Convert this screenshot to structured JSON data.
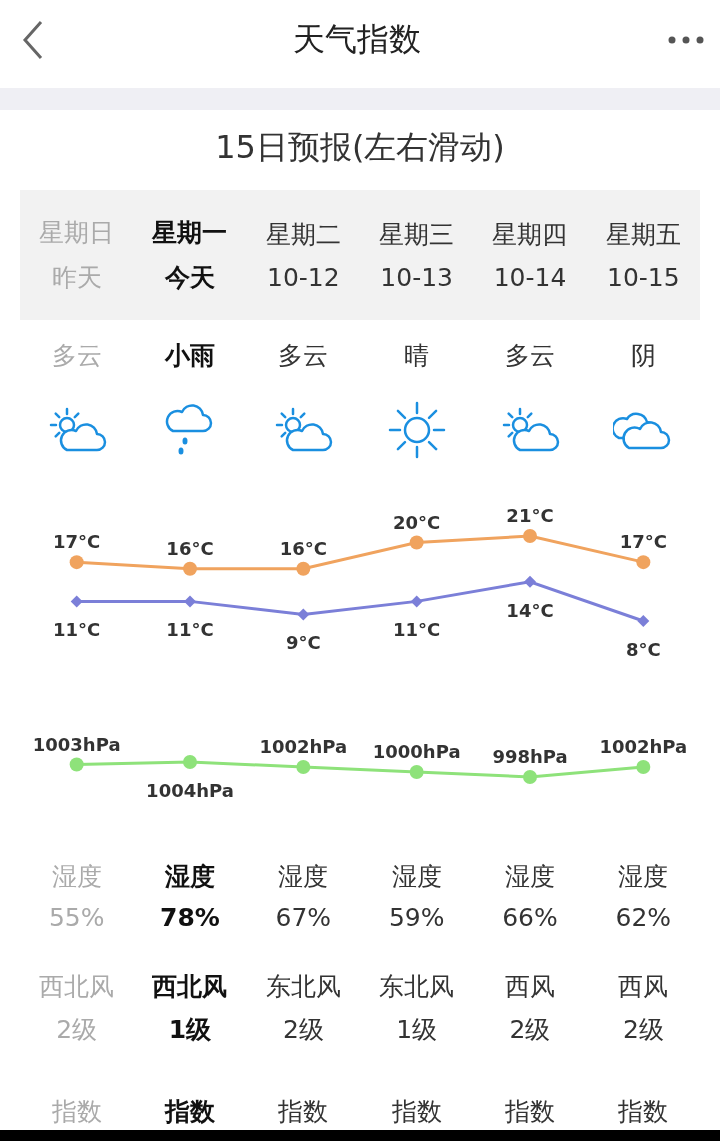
{
  "header": {
    "title": "天气指数"
  },
  "forecast": {
    "title": "15日预报(左右滑动)"
  },
  "days": [
    {
      "kind": "past",
      "weekday": "星期日",
      "date": "昨天",
      "condition": "多云",
      "icon": {
        "kind": "sun-cloud"
      },
      "humidity_label": "湿度",
      "humidity": "55%",
      "wind_dir": "西北风",
      "wind_level": "2级",
      "index_label": "指数"
    },
    {
      "kind": "today",
      "weekday": "星期一",
      "date": "今天",
      "condition": "小雨",
      "icon": {
        "kind": "rain"
      },
      "humidity_label": "湿度",
      "humidity": "78%",
      "wind_dir": "西北风",
      "wind_level": "1级",
      "index_label": "指数"
    },
    {
      "kind": "future",
      "weekday": "星期二",
      "date": "10-12",
      "condition": "多云",
      "icon": {
        "kind": "sun-cloud"
      },
      "humidity_label": "湿度",
      "humidity": "67%",
      "wind_dir": "东北风",
      "wind_level": "2级",
      "index_label": "指数"
    },
    {
      "kind": "future",
      "weekday": "星期三",
      "date": "10-13",
      "condition": "晴",
      "icon": {
        "kind": "sun"
      },
      "humidity_label": "湿度",
      "humidity": "59%",
      "wind_dir": "东北风",
      "wind_level": "1级",
      "index_label": "指数"
    },
    {
      "kind": "future",
      "weekday": "星期四",
      "date": "10-14",
      "condition": "多云",
      "icon": {
        "kind": "sun-cloud"
      },
      "humidity_label": "湿度",
      "humidity": "66%",
      "wind_dir": "西风",
      "wind_level": "2级",
      "index_label": "指数"
    },
    {
      "kind": "future",
      "weekday": "星期五",
      "date": "10-15",
      "condition": "阴",
      "icon": {
        "kind": "cloud"
      },
      "humidity_label": "湿度",
      "humidity": "62%",
      "wind_dir": "西风",
      "wind_level": "2级",
      "index_label": "指数"
    }
  ],
  "temperature_chart": {
    "chart_data": {
      "type": "line",
      "data_labels": true,
      "categories": [
        null,
        null,
        null,
        null,
        null,
        null
      ],
      "series": [
        {
          "color": "#f0a35e",
          "values": [
            17,
            16,
            16,
            20,
            21,
            17
          ],
          "value_labels": [
            "17°C",
            "16°C",
            "16°C",
            "20°C",
            "21°C",
            "17°C"
          ],
          "marker": "circle"
        },
        {
          "color": "#7b7fd8",
          "values": [
            11,
            11,
            9,
            11,
            14,
            8
          ],
          "value_labels": [
            "11°C",
            "11°C",
            "9°C",
            "11°C",
            "14°C",
            "8°C"
          ],
          "marker": "diamond"
        }
      ]
    }
  },
  "pressure_chart": {
    "chart_data": {
      "type": "line",
      "data_labels": true,
      "categories": [
        null,
        null,
        null,
        null,
        null,
        null
      ],
      "series": [
        {
          "color": "#8ee27a",
          "values": [
            1003,
            1004,
            1002,
            1000,
            998,
            1002
          ],
          "value_labels": [
            "1003hPa",
            "1004hPa",
            "1002hPa",
            "1000hPa",
            "998hPa",
            "1002hPa"
          ],
          "marker": "circle"
        }
      ]
    }
  }
}
